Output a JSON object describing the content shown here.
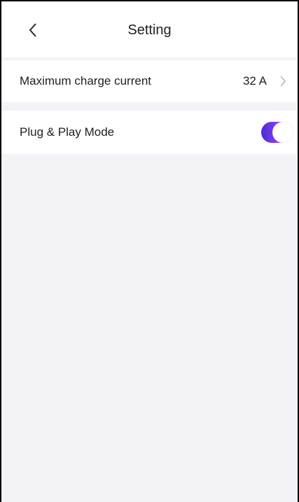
{
  "header": {
    "title": "Setting",
    "back_icon": "chevron-left-icon"
  },
  "settings": {
    "max_current": {
      "label": "Maximum charge current",
      "value": "32 A",
      "icon": "chevron-right-icon"
    },
    "plug_play": {
      "label": "Plug & Play Mode",
      "enabled": true
    }
  },
  "colors": {
    "background": "#f3f2f6",
    "toggle_gradient_start": "#4a2bd6",
    "toggle_gradient_end": "#d33ad9",
    "text": "#1f1f1f"
  }
}
